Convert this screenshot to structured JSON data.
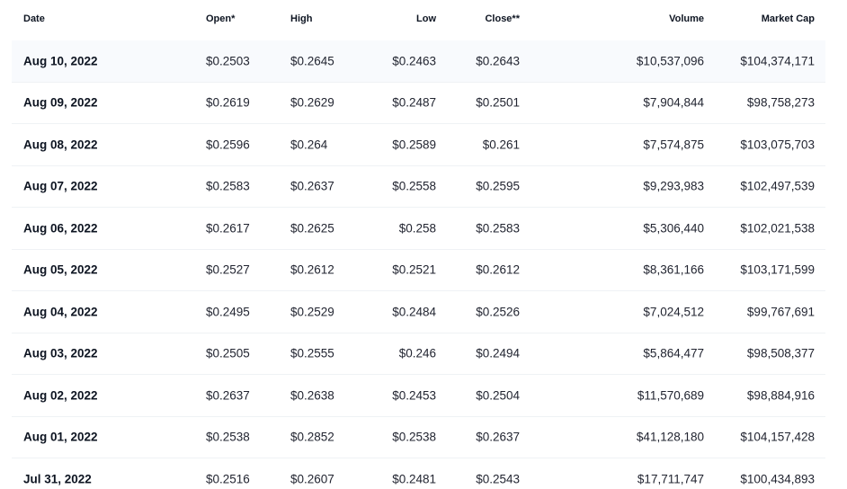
{
  "columns": {
    "date": "Date",
    "open": "Open*",
    "high": "High",
    "low": "Low",
    "close": "Close**",
    "volume": "Volume",
    "market_cap": "Market Cap"
  },
  "rows": [
    {
      "date": "Aug 10, 2022",
      "open": "$0.2503",
      "high": "$0.2645",
      "low": "$0.2463",
      "close": "$0.2643",
      "volume": "$10,537,096",
      "market_cap": "$104,374,171"
    },
    {
      "date": "Aug 09, 2022",
      "open": "$0.2619",
      "high": "$0.2629",
      "low": "$0.2487",
      "close": "$0.2501",
      "volume": "$7,904,844",
      "market_cap": "$98,758,273"
    },
    {
      "date": "Aug 08, 2022",
      "open": "$0.2596",
      "high": "$0.264",
      "low": "$0.2589",
      "close": "$0.261",
      "volume": "$7,574,875",
      "market_cap": "$103,075,703"
    },
    {
      "date": "Aug 07, 2022",
      "open": "$0.2583",
      "high": "$0.2637",
      "low": "$0.2558",
      "close": "$0.2595",
      "volume": "$9,293,983",
      "market_cap": "$102,497,539"
    },
    {
      "date": "Aug 06, 2022",
      "open": "$0.2617",
      "high": "$0.2625",
      "low": "$0.258",
      "close": "$0.2583",
      "volume": "$5,306,440",
      "market_cap": "$102,021,538"
    },
    {
      "date": "Aug 05, 2022",
      "open": "$0.2527",
      "high": "$0.2612",
      "low": "$0.2521",
      "close": "$0.2612",
      "volume": "$8,361,166",
      "market_cap": "$103,171,599"
    },
    {
      "date": "Aug 04, 2022",
      "open": "$0.2495",
      "high": "$0.2529",
      "low": "$0.2484",
      "close": "$0.2526",
      "volume": "$7,024,512",
      "market_cap": "$99,767,691"
    },
    {
      "date": "Aug 03, 2022",
      "open": "$0.2505",
      "high": "$0.2555",
      "low": "$0.246",
      "close": "$0.2494",
      "volume": "$5,864,477",
      "market_cap": "$98,508,377"
    },
    {
      "date": "Aug 02, 2022",
      "open": "$0.2637",
      "high": "$0.2638",
      "low": "$0.2453",
      "close": "$0.2504",
      "volume": "$11,570,689",
      "market_cap": "$98,884,916"
    },
    {
      "date": "Aug 01, 2022",
      "open": "$0.2538",
      "high": "$0.2852",
      "low": "$0.2538",
      "close": "$0.2637",
      "volume": "$41,128,180",
      "market_cap": "$104,157,428"
    },
    {
      "date": "Jul 31, 2022",
      "open": "$0.2516",
      "high": "$0.2607",
      "low": "$0.2481",
      "close": "$0.2543",
      "volume": "$17,711,747",
      "market_cap": "$100,434,893"
    }
  ]
}
